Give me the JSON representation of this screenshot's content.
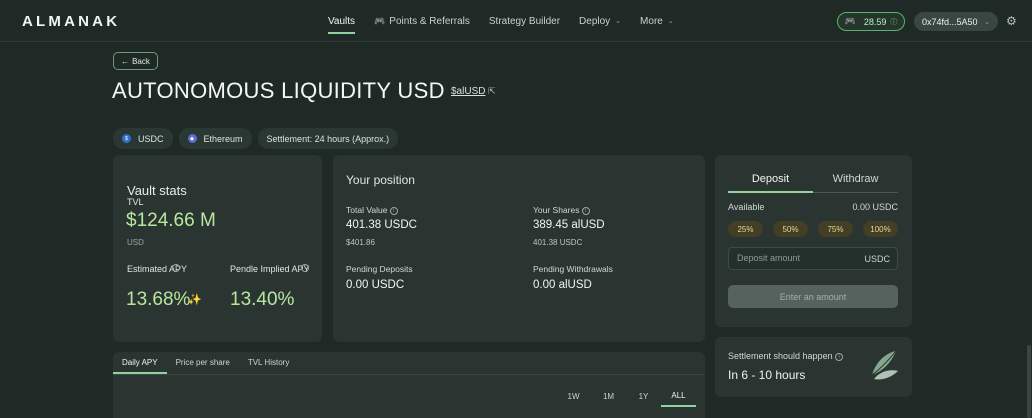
{
  "brand": {
    "logo": "ALMANAK"
  },
  "nav": {
    "items": [
      {
        "label": "Vaults",
        "active": true
      },
      {
        "label": "Points & Referrals",
        "icon": "gamepad-icon"
      },
      {
        "label": "Strategy Builder"
      },
      {
        "label": "Deploy",
        "has_dropdown": true
      },
      {
        "label": "More",
        "has_dropdown": true
      }
    ],
    "points": "28.59",
    "wallet": "0x74fd...5A50"
  },
  "page": {
    "back_label": "Back",
    "title": "AUTONOMOUS LIQUIDITY USD",
    "ticker": "$alUSD",
    "chips": {
      "asset": "USDC",
      "network": "Ethereum",
      "settlement": "Settlement: 24 hours (Approx.)"
    }
  },
  "vault_stats": {
    "title": "Vault stats",
    "tvl_label": "TVL",
    "tvl": "$124.66 M",
    "tvl_unit": "USD",
    "est_apy_label": "Estimated APY",
    "est_apy": "13.68%",
    "pendle_label": "Pendle Implied APY",
    "pendle_apy": "13.40%"
  },
  "position": {
    "title": "Your position",
    "total_value_label": "Total Value",
    "total_value": "401.38 USDC",
    "total_value_usd": "$401.86",
    "shares_label": "Your Shares",
    "shares": "389.45 alUSD",
    "shares_usdc": "401.38 USDC",
    "pending_deposits_label": "Pending Deposits",
    "pending_deposits": "0.00 USDC",
    "pending_withdrawals_label": "Pending Withdrawals",
    "pending_withdrawals": "0.00 alUSD"
  },
  "deposit": {
    "tab_deposit": "Deposit",
    "tab_withdraw": "Withdraw",
    "available_label": "Available",
    "available_value": "0.00 USDC",
    "percents": [
      "25%",
      "50%",
      "75%",
      "100%"
    ],
    "amount_placeholder": "Deposit amount",
    "amount_unit": "USDC",
    "submit_label": "Enter an amount"
  },
  "settlement": {
    "label": "Settlement should happen",
    "value": "In 6 - 10 hours"
  },
  "chart": {
    "tabs": [
      "Daily APY",
      "Price per share",
      "TVL History"
    ],
    "ranges": [
      "1W",
      "1M",
      "1Y",
      "ALL"
    ]
  },
  "colors": {
    "background": "#1f2a27",
    "card": "#2a3531",
    "accent_green": "#b8e6a0",
    "tab_underline": "#8fd3a0",
    "percent_chip": "#433f26"
  }
}
